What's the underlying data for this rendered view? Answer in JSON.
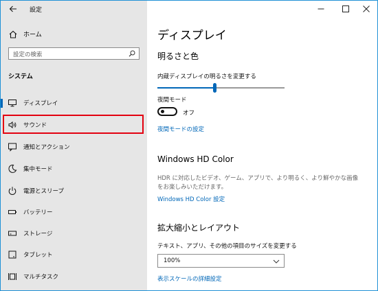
{
  "window": {
    "title": "設定"
  },
  "sidebar": {
    "home_label": "ホーム",
    "search_placeholder": "設定の検索",
    "section_label": "システム",
    "items": [
      {
        "label": "ディスプレイ",
        "icon": "display-icon"
      },
      {
        "label": "サウンド",
        "icon": "speaker-icon"
      },
      {
        "label": "通知とアクション",
        "icon": "notification-icon"
      },
      {
        "label": "集中モード",
        "icon": "moon-icon"
      },
      {
        "label": "電源とスリープ",
        "icon": "power-icon"
      },
      {
        "label": "バッテリー",
        "icon": "battery-icon"
      },
      {
        "label": "ストレージ",
        "icon": "storage-icon"
      },
      {
        "label": "タブレット",
        "icon": "tablet-icon"
      },
      {
        "label": "マルチタスク",
        "icon": "multitask-icon"
      }
    ],
    "selected_index": 0,
    "highlighted_index": 1,
    "accent_color": "#0067b8",
    "highlight_color": "#e3000f"
  },
  "main": {
    "title": "ディスプレイ",
    "brightness": {
      "heading": "明るさと色",
      "slider_label": "内蔵ディスプレイの明るさを変更する",
      "level": 0.45
    },
    "night_light": {
      "label": "夜間モード",
      "state_text": "オフ",
      "settings_link": "夜間モードの設定"
    },
    "hd_color": {
      "heading": "Windows HD Color",
      "description": "HDR に対応したビデオ、ゲーム、アプリで、より明るく、より鮮やかな画像をお楽しみいただけます。",
      "link": "Windows HD Color 設定"
    },
    "scale": {
      "heading": "拡大縮小とレイアウト",
      "label": "テキスト、アプリ、その他の項目のサイズを変更する",
      "selected_value": "100%",
      "advanced_link": "表示スケールの詳細設定"
    }
  }
}
